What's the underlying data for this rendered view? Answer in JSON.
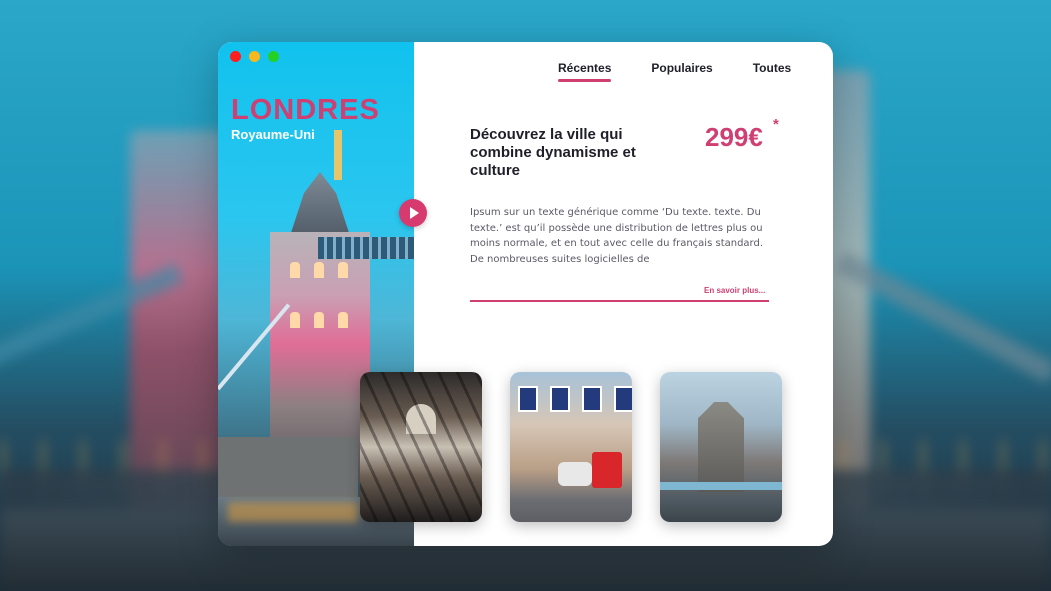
{
  "window": {
    "controls": [
      "close",
      "minimize",
      "maximize"
    ]
  },
  "destination": {
    "city": "LONDRES",
    "country": "Royaume-Uni"
  },
  "nav": {
    "tabs": [
      "Récentes",
      "Populaires",
      "Toutes"
    ],
    "active": "Récentes"
  },
  "offer": {
    "headline": "Découvrez la ville qui combine dynamisme et culture",
    "price": "299€",
    "price_mark": "*",
    "description": "Ipsum sur un texte générique comme ‘Du texte. texte. Du texte.’ est qu’il possède une distribution de lettres plus ou moins normale, et en tout avec celle du français standard. De nombreuses suites logicielles de",
    "more_link": "En savoir plus..."
  },
  "colors": {
    "accent": "#cf3f72",
    "left_panel": "#11c2ee",
    "text": "#1f1f2a"
  },
  "icons": {
    "play": "play-icon"
  }
}
